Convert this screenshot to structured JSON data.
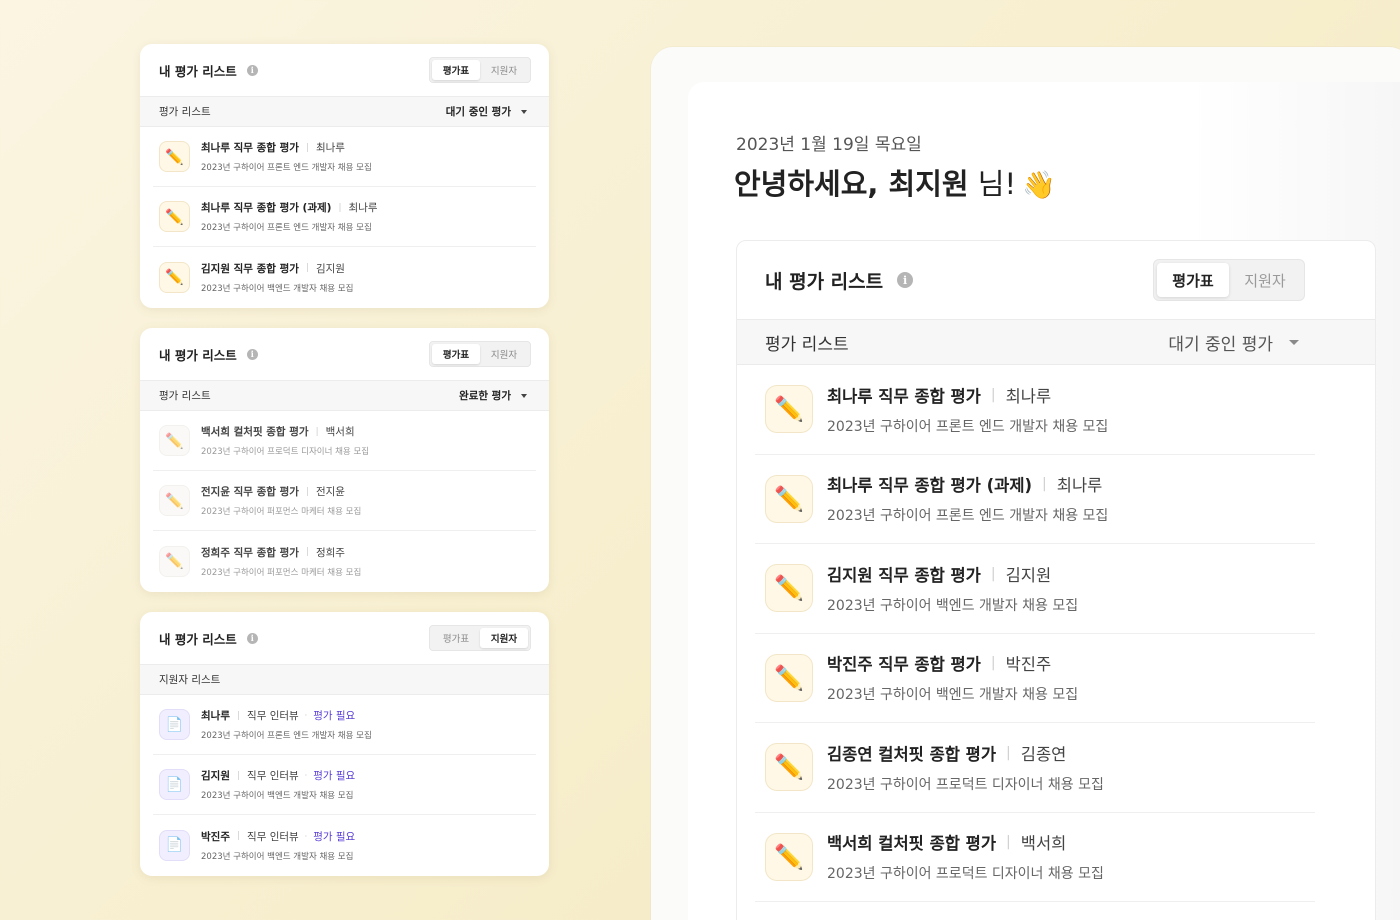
{
  "cards": [
    {
      "title": "내 평가 리스트",
      "info_icon": "ⓘ",
      "toggle": [
        "평가표",
        "지원자"
      ],
      "active_toggle": 0,
      "sub_label": "평가 리스트",
      "dropdown": "대기 중인 평가",
      "rows": [
        {
          "title": "최나루 직무 종합 평가",
          "name": "최나루",
          "desc": "2023년 구하이어 프론트 엔드 개발자 채용 모집",
          "icon": "pencil-icon"
        },
        {
          "title": "최나루 직무 종합 평가 (과제)",
          "name": "최나루",
          "desc": "2023년 구하이어 프론트 엔드 개발자 채용 모집",
          "icon": "pencil-icon"
        },
        {
          "title": "김지원 직무 종합 평가",
          "name": "김지원",
          "desc": "2023년 구하이어 백엔드 개발자 채용 모집",
          "icon": "pencil-icon"
        }
      ]
    },
    {
      "title": "내 평가 리스트",
      "info_icon": "ⓘ",
      "toggle": [
        "평가표",
        "지원자"
      ],
      "active_toggle": 0,
      "sub_label": "평가 리스트",
      "dropdown": "완료한 평가",
      "rows": [
        {
          "title": "백서희 컬처핏 종합 평가",
          "name": "백서희",
          "desc": "2023년 구하이어 프로덕트 디자이너 채용 모집",
          "icon": "pencil-icon"
        },
        {
          "title": "전지윤 직무 종합 평가",
          "name": "전지윤",
          "desc": "2023년 구하이어 퍼포먼스 마케터 채용 모집",
          "icon": "pencil-icon"
        },
        {
          "title": "정희주 직무 종합 평가",
          "name": "정희주",
          "desc": "2023년 구하이어 퍼포먼스 마케터 채용 모집",
          "icon": "pencil-icon"
        }
      ]
    },
    {
      "title": "내 평가 리스트",
      "info_icon": "ⓘ",
      "toggle": [
        "평가표",
        "지원자"
      ],
      "active_toggle": 1,
      "sub_label": "지원자 리스트",
      "rows": [
        {
          "title": "최나루",
          "name": "직무 인터뷰",
          "tag": "평가 필요",
          "desc": "2023년 구하이어 프론트 엔드 개발자 채용 모집",
          "icon": "document-icon"
        },
        {
          "title": "김지원",
          "name": "직무 인터뷰",
          "tag": "평가 필요",
          "desc": "2023년 구하이어 백엔드 개발자 채용 모집",
          "icon": "document-icon"
        },
        {
          "title": "박진주",
          "name": "직무 인터뷰",
          "tag": "평가 필요",
          "desc": "2023년 구하이어 백엔드 개발자 채용 모집",
          "icon": "document-icon"
        }
      ]
    }
  ],
  "main": {
    "date": "2023년 1월 19일 목요일",
    "greeting_prefix": "안녕하세요, 최지원",
    "greeting_suffix": " 님!",
    "greeting_emoji": "👋",
    "card": {
      "title": "내 평가 리스트",
      "info_icon": "ⓘ",
      "toggle": [
        "평가표",
        "지원자"
      ],
      "active_toggle": 0,
      "sub_label": "평가 리스트",
      "dropdown": "대기 중인 평가",
      "rows": [
        {
          "title": "최나루 직무 종합 평가",
          "name": "최나루",
          "desc": "2023년 구하이어 프론트 엔드 개발자 채용 모집"
        },
        {
          "title": "최나루 직무 종합 평가 (과제)",
          "name": "최나루",
          "desc": "2023년 구하이어 프론트 엔드 개발자 채용 모집"
        },
        {
          "title": "김지원 직무 종합 평가",
          "name": "김지원",
          "desc": "2023년 구하이어 백엔드 개발자 채용 모집"
        },
        {
          "title": "박진주 직무 종합 평가",
          "name": "박진주",
          "desc": "2023년 구하이어 백엔드 개발자 채용 모집"
        },
        {
          "title": "김종연 컬처핏 종합 평가",
          "name": "김종연",
          "desc": "2023년 구하이어 프로덕트 디자이너 채용 모집"
        },
        {
          "title": "백서희 컬처핏 종합 평가",
          "name": "백서희",
          "desc": "2023년 구하이어 프로덕트 디자이너 채용 모집"
        }
      ]
    }
  },
  "glyphs": {
    "pencil": "✏️",
    "document": "📄",
    "separator": "|",
    "dot": "·"
  }
}
